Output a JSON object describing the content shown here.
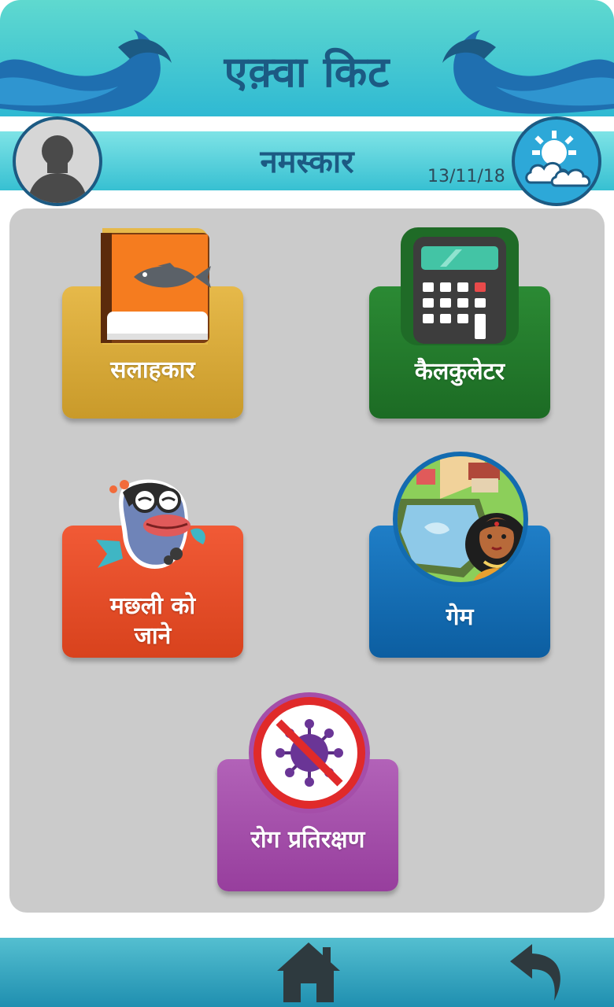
{
  "header": {
    "app_title": "एक़्वा किट",
    "greeting": "नमस्कार",
    "date": "13/11/18"
  },
  "cards": {
    "advisor": "सलाहकार",
    "calculator": "कैलकुलेटर",
    "fish_line1": "मछली को",
    "fish_line2": "जाने",
    "game": "गेम",
    "disease": "रोग प्रतिरक्षण"
  },
  "icons": {
    "avatar": "user-avatar-icon",
    "weather": "weather-partly-cloudy-icon",
    "advisor": "fish-book-icon",
    "calculator": "calculator-icon",
    "fish": "cartoon-fish-icon",
    "game": "village-pond-icon",
    "disease": "no-virus-icon",
    "home": "home-icon",
    "back": "back-arrow-icon"
  },
  "colors": {
    "header_teal": "#2fb9d3",
    "title_blue": "#1c5a83",
    "advisor": "#d4a638",
    "calculator": "#237a2c",
    "fish": "#e44e2a",
    "game": "#136bb0",
    "disease": "#a54ea9"
  }
}
